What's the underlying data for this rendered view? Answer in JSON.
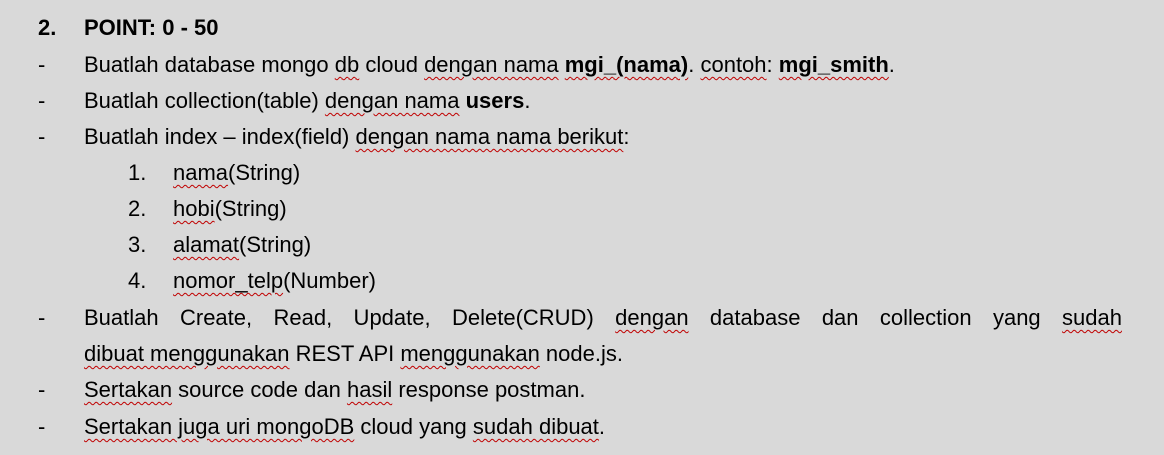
{
  "heading": {
    "number": "2.",
    "title": "POINT: 0 - 50"
  },
  "bullets": {
    "dash": "-",
    "b1": {
      "t1": "Buatlah database mongo ",
      "t2": "db",
      "t3": " cloud ",
      "t4": "dengan nama",
      "t5": " ",
      "t6": "mgi_(nama)",
      "t7": ". ",
      "t8": "contoh",
      "t9": ": ",
      "t10": "mgi_smith",
      "t11": "."
    },
    "b2": {
      "t1": "Buatlah collection(table) ",
      "t2": "dengan nama",
      "t3": " ",
      "t4": "users",
      "t5": "."
    },
    "b3": {
      "t1": "Buatlah index – index(field) ",
      "t2": "dengan nama nama berikut",
      "t3": ":"
    },
    "b4": {
      "line1": {
        "t1": "Buatlah Create, Read, Update, Delete(CRUD) ",
        "t2": "dengan",
        "t3": " database dan collection yang ",
        "t4": "sudah"
      },
      "line2": {
        "t1": "dibuat menggunakan",
        "t2": " REST API ",
        "t3": "menggunakan",
        "t4": " node.js."
      }
    },
    "b5": {
      "t1": "Sertakan",
      "t2": " source code dan ",
      "t3": "hasil",
      "t4": " response postman."
    },
    "b6": {
      "t1": "Sertakan juga uri mongoDB",
      "t2": " cloud yang ",
      "t3": "sudah dibuat",
      "t4": "."
    }
  },
  "fields": [
    {
      "number": "1.",
      "name": "nama",
      "type": "(String)"
    },
    {
      "number": "2.",
      "name": "hobi",
      "type": "(String)"
    },
    {
      "number": "3.",
      "name": "alamat",
      "type": "(String)"
    },
    {
      "number": "4.",
      "name": "nomor_telp",
      "type": "(Number)"
    }
  ],
  "colors": {
    "background": "#d9d9d9",
    "spellcheck_squiggle": "#c00000"
  }
}
